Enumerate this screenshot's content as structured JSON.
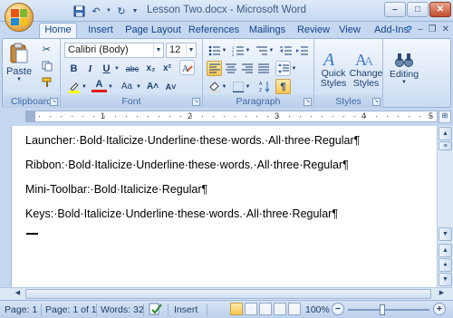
{
  "window": {
    "title": "Lesson Two.docx - Microsoft Word",
    "minimize": "–",
    "maximize": "□",
    "close": "✕"
  },
  "tabs": [
    "Home",
    "Insert",
    "Page Layout",
    "References",
    "Mailings",
    "Review",
    "View",
    "Add-Ins"
  ],
  "active_tab": "Home",
  "ribbon": {
    "clipboard": {
      "label": "Clipboard",
      "paste": "Paste"
    },
    "font": {
      "label": "Font",
      "name": "Calibri (Body)",
      "size": "12",
      "bold": "B",
      "italic": "I",
      "underline": "U",
      "strikethrough": "abc",
      "subscript": "x₂",
      "superscript": "x²",
      "font_color": "A",
      "change_case": "Aa",
      "grow": "A˄",
      "shrink": "A˅"
    },
    "paragraph": {
      "label": "Paragraph"
    },
    "styles": {
      "label": "Styles",
      "quick_styles": [
        "Quick",
        "Styles"
      ],
      "change_styles": [
        "Change",
        "Styles"
      ]
    },
    "editing": {
      "label": "Editing"
    }
  },
  "document": {
    "lines": [
      "Launcher:·Bold·Italicize·Underline·these·words.·All·three·Regular¶",
      "Ribbon:·Bold·Italicize·Underline·these·words.·All·three·Regular¶",
      "Mini-Toolbar:·Bold·Italicize·Regular¶",
      "Keys:·Bold·Italicize·Underline·these·words.·All·three·Regular¶"
    ]
  },
  "status": {
    "page": "Page: 1",
    "page_of": "Page: 1 of 1",
    "words": "Words: 32",
    "mode": "Insert",
    "zoom": "100%"
  },
  "ruler_marks": [
    "1",
    "2",
    "3",
    "4",
    "5"
  ],
  "colors": {
    "accent": "#15428b",
    "font_color": "#e01b1b",
    "highlight": "#f8c651"
  }
}
